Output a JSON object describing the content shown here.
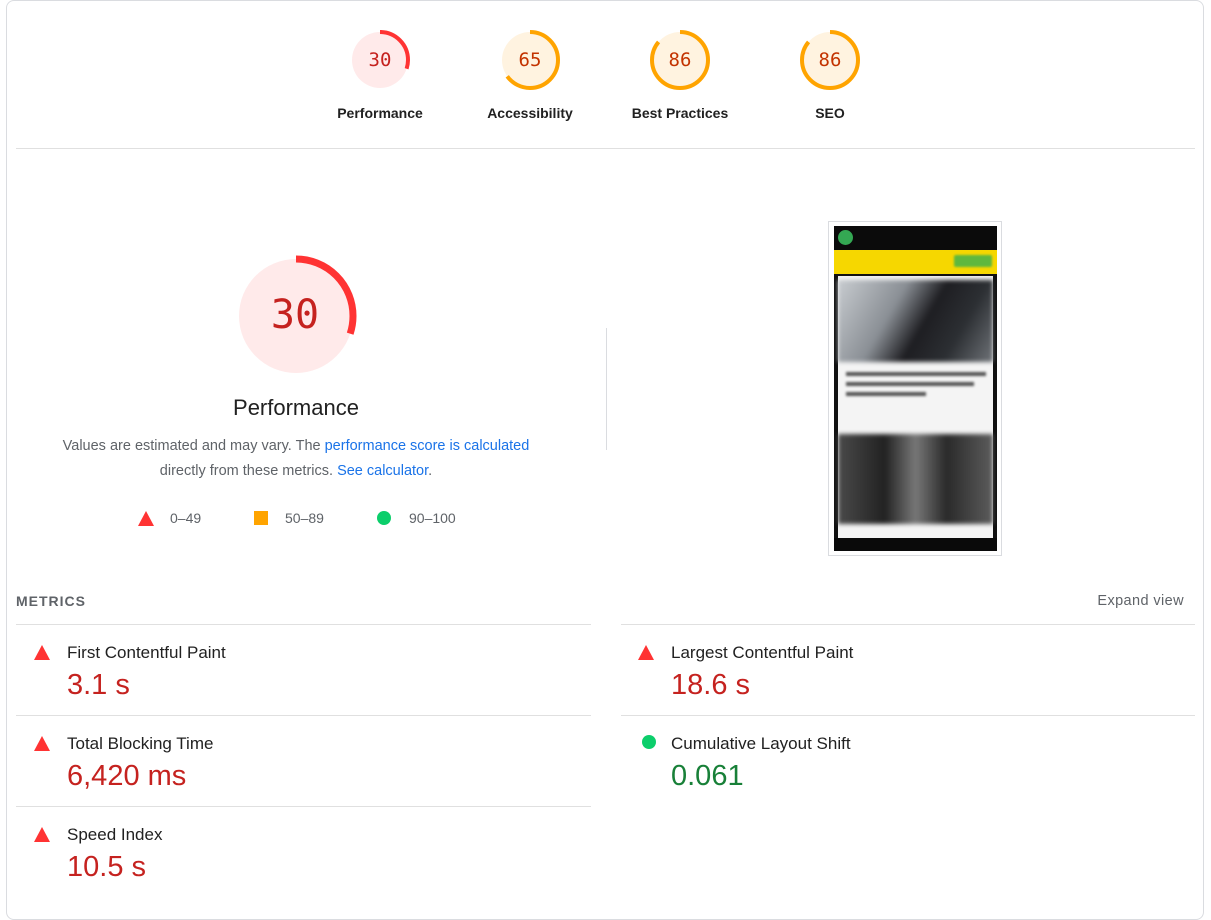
{
  "categories": [
    {
      "label": "Performance",
      "score": "30",
      "value": 0.3,
      "color": "#ff3333",
      "bg": "#ffeaea",
      "text_color": "#c5221f"
    },
    {
      "label": "Accessibility",
      "score": "65",
      "value": 0.65,
      "color": "#ffa400",
      "bg": "#fff3e0",
      "text_color": "#c33300"
    },
    {
      "label": "Best Practices",
      "score": "86",
      "value": 0.86,
      "color": "#ffa400",
      "bg": "#fff3e0",
      "text_color": "#c33300"
    },
    {
      "label": "SEO",
      "score": "86",
      "value": 0.86,
      "color": "#ffa400",
      "bg": "#fff3e0",
      "text_color": "#c33300"
    }
  ],
  "performance": {
    "score": "30",
    "value": 0.3,
    "title": "Performance",
    "desc_prefix": "Values are estimated and may vary. The ",
    "desc_link1": "performance score is calculated",
    "desc_middle": " directly from these metrics. ",
    "desc_link2": "See calculator",
    "desc_suffix": "."
  },
  "legend": [
    {
      "icon": "fail-triangle-icon",
      "range": "0–49"
    },
    {
      "icon": "average-square-icon",
      "range": "50–89"
    },
    {
      "icon": "pass-circle-icon",
      "range": "90–100"
    }
  ],
  "metrics_section": {
    "header": "METRICS",
    "expand_label": "Expand view"
  },
  "metrics": [
    {
      "name": "First Contentful Paint",
      "value": "3.1 s",
      "status": "fail"
    },
    {
      "name": "Largest Contentful Paint",
      "value": "18.6 s",
      "status": "fail"
    },
    {
      "name": "Total Blocking Time",
      "value": "6,420 ms",
      "status": "fail"
    },
    {
      "name": "Cumulative Layout Shift",
      "value": "0.061",
      "status": "pass"
    },
    {
      "name": "Speed Index",
      "value": "10.5 s",
      "status": "fail"
    }
  ]
}
